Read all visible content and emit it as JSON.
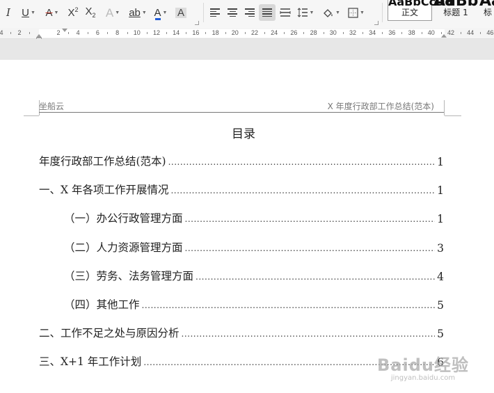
{
  "toolbar": {
    "italic": "I",
    "underline": "U",
    "strikethrough": "A",
    "superscript": "X",
    "superscript_mark": "2",
    "subscript": "X",
    "subscript_mark": "2",
    "text_effect": "A",
    "highlight": "ab",
    "font_color": "A",
    "char_shading": "A",
    "font_color_hex": "#1f5bd8"
  },
  "styles_gallery": [
    {
      "preview": "AaBbCcDd",
      "label": "正文",
      "active": true
    },
    {
      "preview": "AaBb",
      "label": "标题 1"
    },
    {
      "preview": "AaBl",
      "label": "标"
    }
  ],
  "ruler": {
    "labels": [
      "4",
      "2",
      "2",
      "4",
      "6",
      "8",
      "10",
      "12",
      "14",
      "16",
      "18",
      "20",
      "22",
      "24",
      "26",
      "28",
      "30",
      "32",
      "34",
      "36",
      "38",
      "40",
      "42",
      "44",
      "46"
    ]
  },
  "document": {
    "header_left": "坐船云",
    "header_right": "X 年度行政部工作总结(范本)",
    "toc_title": "目录",
    "toc_entries": [
      {
        "text": "年度行政部工作总结(范本)",
        "page": "1",
        "level": 1
      },
      {
        "text": "一、X 年各项工作开展情况",
        "page": "1",
        "level": 1
      },
      {
        "text": "（一）办公行政管理方面",
        "page": "1",
        "level": 2
      },
      {
        "text": "（二）人力资源管理方面",
        "page": "3",
        "level": 2
      },
      {
        "text": "（三）劳务、法务管理方面",
        "page": "4",
        "level": 2
      },
      {
        "text": "（四）其他工作",
        "page": "5",
        "level": 2
      },
      {
        "text": "二、工作不足之处与原因分析",
        "page": "5",
        "level": 1
      },
      {
        "text": "三、X+1 年工作计划",
        "page": "6",
        "level": 1
      }
    ]
  },
  "watermark": {
    "logo": "Baidu经验",
    "url": "jingyan.baidu.com"
  }
}
